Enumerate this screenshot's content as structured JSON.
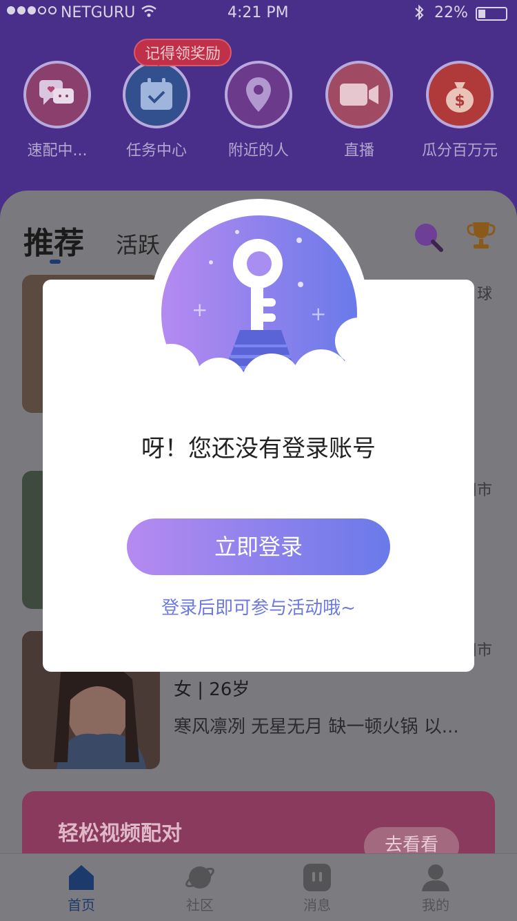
{
  "status_bar": {
    "carrier": "NETGURU",
    "time": "4:21 PM",
    "battery": "22%"
  },
  "features": {
    "reward_badge": "记得领奖励",
    "items": [
      {
        "label": "速配中..."
      },
      {
        "label": "任务中心"
      },
      {
        "label": "附近的人"
      },
      {
        "label": "直播"
      },
      {
        "label": "瓜分百万元"
      }
    ]
  },
  "tabs": {
    "recommend": "推荐",
    "active": "活跃"
  },
  "cards": [
    {
      "location": "球"
    },
    {
      "location": "川市"
    },
    {
      "location": "川市",
      "info": "女 | 26岁",
      "bio": "寒风凛冽 无星无月 缺一顿火锅 以..."
    }
  ],
  "banner": {
    "title": "轻松视频配对",
    "button": "去看看"
  },
  "bottom_nav": {
    "items": [
      {
        "label": "首页"
      },
      {
        "label": "社区"
      },
      {
        "label": "消息"
      },
      {
        "label": "我的"
      }
    ]
  },
  "modal": {
    "message": "呀！您还没有登录账号",
    "login_button": "立即登录",
    "hint": "登录后即可参与活动哦~"
  },
  "colors": {
    "header_purple": "#4a2f8a",
    "gradient_start": "#b58af0",
    "gradient_end": "#6a7ae9",
    "hint_blue": "#6c79e0"
  }
}
